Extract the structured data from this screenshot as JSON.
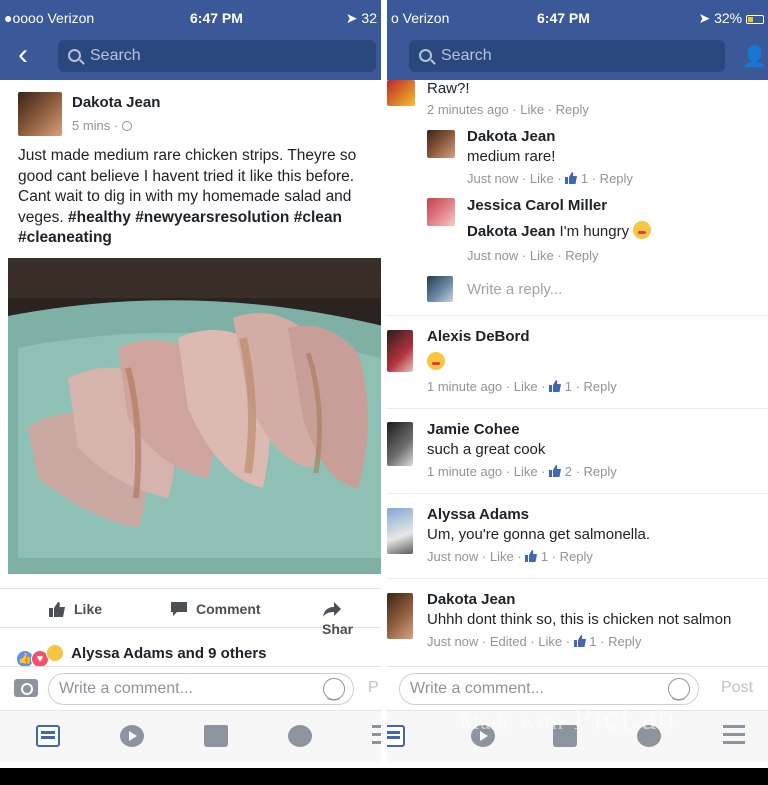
{
  "left": {
    "status": {
      "carrier": "●oooo Verizon",
      "time": "6:47 PM",
      "battery": "32"
    },
    "search": {
      "placeholder": "Search"
    },
    "post": {
      "author": "Dakota Jean",
      "time": "5 mins",
      "text": "Just made medium rare chicken strips. Theyre so good cant believe I havent tried it like this before. Cant wait to dig in with my homemade salad and veges.",
      "hashtags": [
        "#healthy",
        "#newyearsresolution",
        "#clean",
        "#cleaneating"
      ]
    },
    "actions": {
      "like": "Like",
      "comment": "Comment",
      "share": "Shar"
    },
    "reactions_text": "Alyssa Adams and 9 others",
    "comment_placeholder": "Write a comment...",
    "post_label": "P"
  },
  "right": {
    "status": {
      "carrier": "o Verizon",
      "time": "6:47 PM",
      "battery": "32%"
    },
    "search": {
      "placeholder": "Search"
    },
    "top_fragment": {
      "text": "Raw?!",
      "meta": "2 minutes ago · Like · Reply"
    },
    "replies": [
      {
        "name": "Dakota Jean",
        "text": "medium rare!",
        "meta_prefix": "Just now · Like · ",
        "likes": "1",
        "meta_suffix": " · Reply"
      },
      {
        "name": "Jessica Carol Miller",
        "mention": "Dakota Jean",
        "text": " I'm hungry",
        "meta": "Just now · Like · Reply"
      }
    ],
    "write_reply": "Write a reply...",
    "comments": [
      {
        "name": "Alexis DeBord",
        "text": "",
        "meta_prefix": "1 minute ago · Like · ",
        "likes": "1",
        "meta_suffix": " · Reply"
      },
      {
        "name": "Jamie Cohee",
        "text": "such a great cook",
        "meta_prefix": "1 minute ago · Like · ",
        "likes": "2",
        "meta_suffix": " · Reply"
      },
      {
        "name": "Alyssa Adams",
        "text": "Um, you're gonna get salmonella.",
        "meta_prefix": "Just now · Like · ",
        "likes": "1",
        "meta_suffix": " · Reply"
      },
      {
        "name": "Dakota Jean",
        "text": "Uhhh dont think so, this is chicken not salmon",
        "meta_prefix": "Just now · Edited · Like · ",
        "likes": "1",
        "meta_suffix": " · Reply"
      }
    ],
    "comment_placeholder": "Write a comment...",
    "post_label": "Post"
  },
  "watermark": {
    "made_with": "Made with",
    "brand": "PicLab"
  },
  "colors": {
    "facebook_blue": "#3b5998",
    "link_blue": "#4267b2",
    "meta_gray": "#90949c"
  }
}
